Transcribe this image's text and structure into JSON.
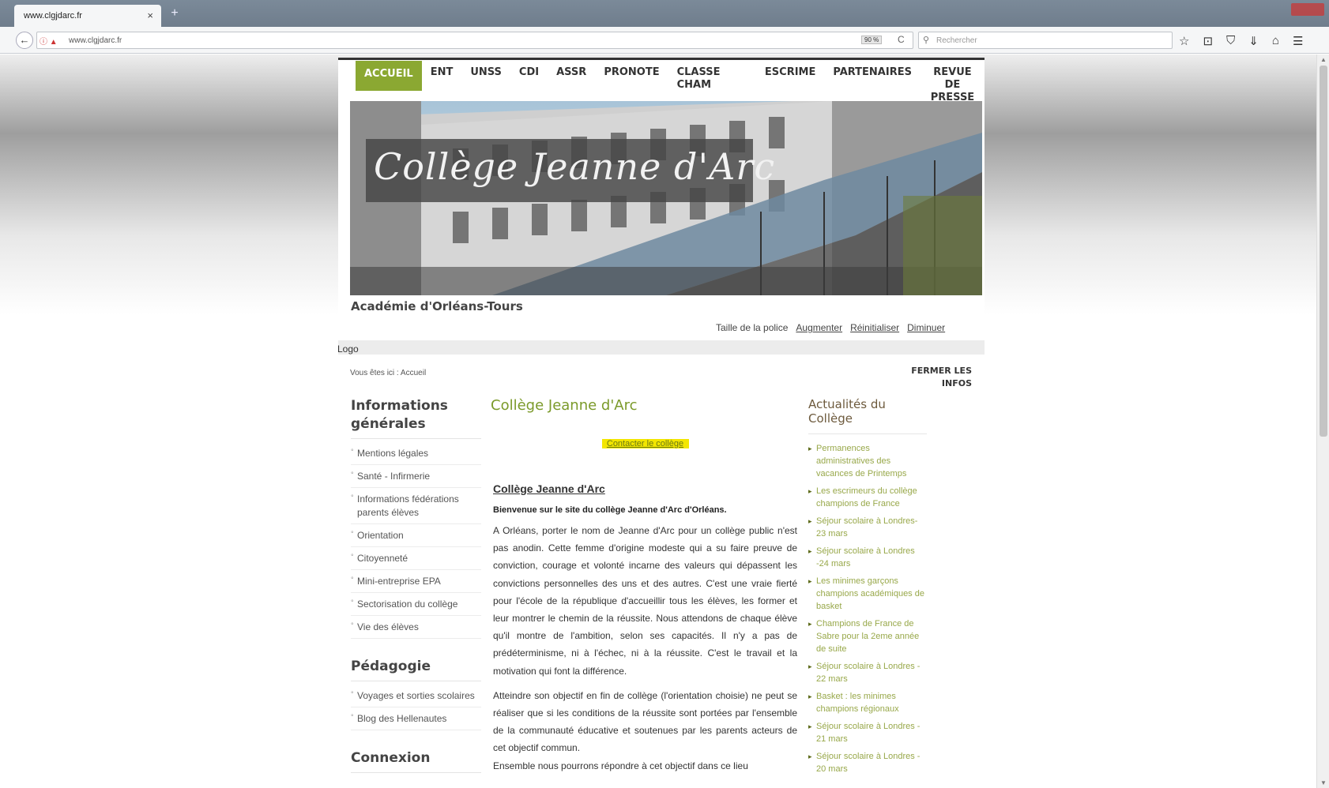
{
  "browser": {
    "tab_title": "www.clgjdarc.fr",
    "tab_close": "×",
    "new_tab": "+",
    "back": "←",
    "url": "www.clgjdarc.fr",
    "zoom": "90 %",
    "reload": "C",
    "search_placeholder": "Rechercher",
    "toolbar_icons": [
      "☆",
      "⊡",
      "⛉",
      "⇓",
      "⌂",
      "☰"
    ]
  },
  "site": {
    "menu": [
      {
        "label": "ACCUEIL",
        "active": true
      },
      {
        "label": "ENT"
      },
      {
        "label": "UNSS"
      },
      {
        "label": "CDI"
      },
      {
        "label": "ASSR"
      },
      {
        "label": "PRONOTE"
      },
      {
        "label": "CLASSE CHAM"
      },
      {
        "label": "ESCRIME"
      },
      {
        "label": "PARTENAIRES"
      },
      {
        "label": "REVUE DE PRESSE"
      }
    ],
    "banner_title": "Collège Jeanne d'Arc",
    "academie": "Académie d'Orléans-Tours",
    "font_size": {
      "label": "Taille de la police",
      "increase": "Augmenter",
      "reset": "Réinitialiser",
      "decrease": "Diminuer"
    },
    "logo_alt": "Logo",
    "breadcrumb": "Vous êtes ici : Accueil",
    "close_infos": "FERMER LES INFOS"
  },
  "left": {
    "heading_info": "Informations générales",
    "info_items": [
      "Mentions légales",
      "Santé - Infirmerie",
      "Informations fédérations parents élèves",
      "Orientation",
      "Citoyenneté",
      "Mini-entreprise EPA",
      "Sectorisation du collège",
      "Vie des élèves"
    ],
    "heading_peda": "Pédagogie",
    "peda_items": [
      "Voyages et sorties scolaires",
      "Blog des Hellenautes"
    ],
    "heading_connexion": "Connexion"
  },
  "center": {
    "title": "Collège Jeanne d'Arc",
    "contact": "Contacter le collège",
    "article_heading": "Collège Jeanne d'Arc",
    "lead": "Bienvenue sur le site du collège Jeanne d'Arc d'Orléans.",
    "p1": "A Orléans, porter le nom de Jeanne d'Arc pour un collège public n'est pas anodin. Cette femme d'origine modeste qui a su faire preuve de conviction, courage et volonté incarne des valeurs qui dépassent les convictions personnelles des uns et des autres. C'est une vraie fierté pour l'école de la république d'accueillir tous les élèves, les former et leur montrer le chemin de la réussite. Nous attendons de chaque élève qu'il montre de l'ambition, selon ses capacités. Il n'y a pas de prédéterminisme, ni à l'échec, ni à la réussite. C'est le travail et la motivation qui font la différence.",
    "p2": "Atteindre son objectif en fin de collège (l'orientation choisie) ne peut se réaliser que si les conditions de la réussite sont portées par l'ensemble de la communauté éducative et soutenues par les parents acteurs de cet objectif commun.",
    "p3": "Ensemble nous pourrons répondre à cet objectif dans ce lieu"
  },
  "right": {
    "heading": "Actualités du Collège",
    "news": [
      "Permanences administratives des vacances de Printemps",
      "Les escrimeurs du collège champions de France",
      "Séjour scolaire à Londres- 23 mars",
      "Séjour scolaire à Londres -24 mars",
      "Les minimes garçons champions académiques de basket",
      "Champions de France de Sabre pour la 2eme année de suite",
      "Séjour scolaire à Londres - 22 mars",
      "Basket : les minimes champions régionaux",
      "Séjour scolaire à Londres - 21 mars",
      "Séjour scolaire à Londres - 20 mars"
    ]
  },
  "colors": {
    "menu_active": "#8ba832",
    "title_green": "#7b9a2a",
    "news_green": "#98a84a",
    "contact_highlight": "#f3e600"
  }
}
